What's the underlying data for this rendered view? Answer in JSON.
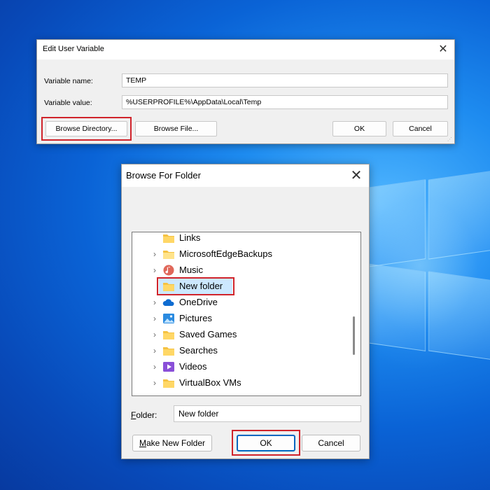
{
  "edit_dialog": {
    "title": "Edit User Variable",
    "name_label": "Variable name:",
    "name_value": "TEMP",
    "value_label": "Variable value:",
    "value_value": "%USERPROFILE%\\AppData\\Local\\Temp",
    "browse_directory_label": "Browse Directory...",
    "browse_file_label": "Browse File...",
    "ok_label": "OK",
    "cancel_label": "Cancel"
  },
  "browse_dialog": {
    "title": "Browse For Folder",
    "tree_items": [
      {
        "label": "Links",
        "icon": "folder-icon",
        "expandable": false
      },
      {
        "label": "MicrosoftEdgeBackups",
        "icon": "folder-icon",
        "expandable": true
      },
      {
        "label": "Music",
        "icon": "music-icon",
        "expandable": true
      },
      {
        "label": "New folder",
        "icon": "folder-icon",
        "expandable": false,
        "selected": true
      },
      {
        "label": "OneDrive",
        "icon": "cloud-icon",
        "expandable": true
      },
      {
        "label": "Pictures",
        "icon": "pictures-icon",
        "expandable": true
      },
      {
        "label": "Saved Games",
        "icon": "folder-icon",
        "expandable": true
      },
      {
        "label": "Searches",
        "icon": "folder-icon",
        "expandable": true
      },
      {
        "label": "Videos",
        "icon": "videos-icon",
        "expandable": true
      },
      {
        "label": "VirtualBox VMs",
        "icon": "folder-icon",
        "expandable": true
      }
    ],
    "folder_label_prefix": "F",
    "folder_label_rest": "older:",
    "folder_value": "New folder",
    "make_new_folder_prefix": "M",
    "make_new_folder_rest": "ake New Folder",
    "ok_label": "OK",
    "cancel_label": "Cancel"
  },
  "colors": {
    "highlight": "#d0242b",
    "selection": "#cce8ff",
    "default_button_border": "#0067c0",
    "folder": "#f5c242"
  }
}
